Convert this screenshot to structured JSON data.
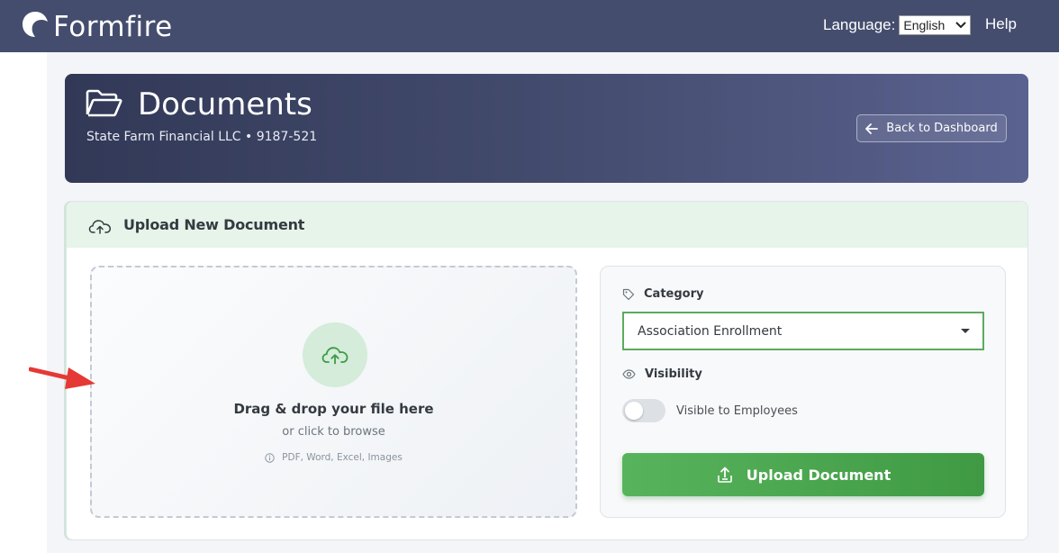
{
  "app": {
    "name": "Formfire"
  },
  "topbar": {
    "language_label": "Language:",
    "language_selected": "English",
    "help_label": "Help"
  },
  "header": {
    "title": "Documents",
    "subtitle": "State Farm Financial LLC • 9187-521",
    "back_label": "Back to Dashboard"
  },
  "upload_card": {
    "title": "Upload New Document",
    "dropzone": {
      "title": "Drag & drop your file here",
      "subtitle": "or click to browse",
      "file_types": "PDF, Word, Excel, Images"
    },
    "category": {
      "label": "Category",
      "selected": "Association Enrollment"
    },
    "visibility": {
      "label": "Visibility",
      "toggle_label": "Visible to Employees",
      "toggle_on": false
    },
    "submit_label": "Upload Document"
  },
  "icons": {
    "logo": "formfire-logo-icon",
    "header": "folder-open-icon",
    "back": "arrow-left-icon",
    "card": "cloud-upload-icon",
    "category": "tag-icon",
    "visibility": "eye-icon",
    "info": "info-icon",
    "upload": "file-upload-icon",
    "annotation": "red-arrow-icon"
  },
  "colors": {
    "topbar": "#454d6e",
    "accent_green": "#4caf50",
    "card_header": "#e6f4ea",
    "annotation_red": "#e53935"
  }
}
